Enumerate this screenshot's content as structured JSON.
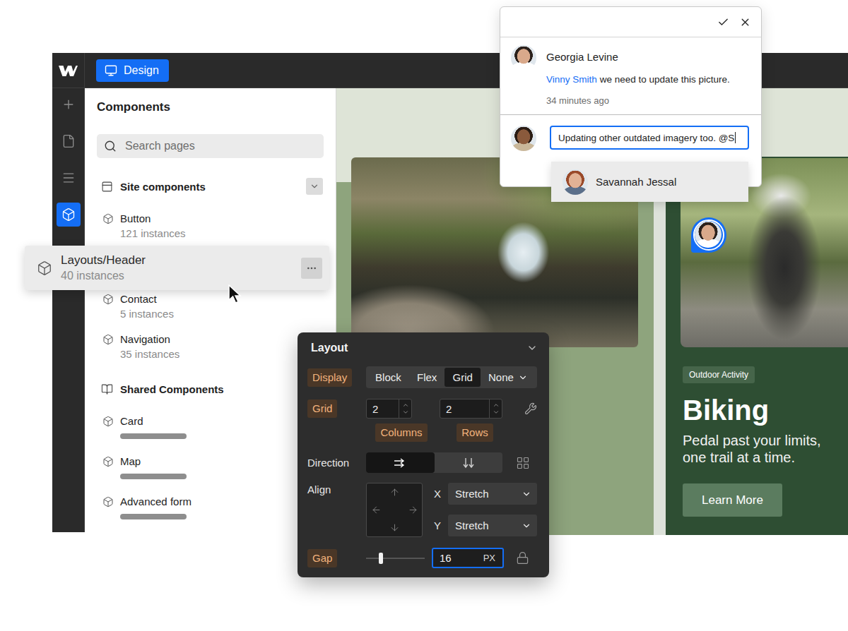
{
  "toolbar": {
    "mode": {
      "label": "Design",
      "selected": true
    }
  },
  "rail": [
    {
      "kind": "add",
      "selected": false
    },
    {
      "kind": "pages",
      "selected": false
    },
    {
      "kind": "navigator",
      "selected": false
    },
    {
      "kind": "components",
      "selected": true
    }
  ],
  "components_panel": {
    "title": "Components",
    "search": {
      "placeholder": "Search pages"
    },
    "sections": [
      {
        "title": "Site components",
        "kind": "site",
        "expanded": true,
        "items": [
          {
            "name": "Button",
            "count": "121 instances",
            "kind": "counted",
            "dragging": false
          },
          {
            "name": "Layouts/Header",
            "count": "40 instances",
            "kind": "counted",
            "dragging": true
          },
          {
            "name": "Contact",
            "count": "5 instances",
            "kind": "counted",
            "dragging": false
          },
          {
            "name": "Navigation",
            "count": "35 instances",
            "kind": "counted",
            "dragging": false
          }
        ]
      },
      {
        "title": "Shared Components",
        "kind": "shared",
        "items": [
          {
            "name": "Card",
            "kind": "loading",
            "dragging": false
          },
          {
            "name": "Map",
            "kind": "loading",
            "dragging": false
          },
          {
            "name": "Advanced form",
            "kind": "loading",
            "dragging": false
          }
        ]
      }
    ]
  },
  "canvas": {
    "feature_card": {
      "tag": "Outdoor Activity",
      "title": "Biking",
      "description": "Pedal past your limits, one trail at a time.",
      "button": "Learn More"
    }
  },
  "comment_thread": {
    "comments": [
      {
        "author": "Georgia Levine",
        "mention": "Vinny Smith",
        "text": "we need to update this picture.",
        "time": "34 minutes ago"
      }
    ],
    "reply": {
      "value": "Updating other outdated imagery too. @S",
      "focused": true
    },
    "suggestions": [
      {
        "name": "Savannah Jessal",
        "selected": true
      }
    ]
  },
  "layout_panel": {
    "title": "Layout",
    "expanded": true,
    "display": {
      "label": "Display",
      "set": true,
      "options": [
        {
          "label": "Block",
          "kind": "button",
          "selected": false
        },
        {
          "label": "Flex",
          "kind": "button",
          "selected": false
        },
        {
          "label": "Grid",
          "kind": "button",
          "selected": true
        },
        {
          "label": "None",
          "kind": "dropdown",
          "selected": false
        }
      ]
    },
    "grid": {
      "label": "Grid",
      "set": true,
      "fields": [
        {
          "value": "2",
          "caption": "Columns",
          "set": true
        },
        {
          "value": "2",
          "caption": "Rows",
          "set": true
        }
      ]
    },
    "direction": {
      "label": "Direction",
      "set": false,
      "options": [
        {
          "kind": "row",
          "selected": true
        },
        {
          "kind": "column",
          "selected": false
        }
      ]
    },
    "align": {
      "label": "Align",
      "set": false,
      "selects": [
        {
          "axis": "X",
          "value": "Stretch"
        },
        {
          "axis": "Y",
          "value": "Stretch"
        }
      ]
    },
    "gap": {
      "label": "Gap",
      "set": true,
      "level": 0.25,
      "value": "16",
      "unit": "PX",
      "focused": true
    }
  }
}
